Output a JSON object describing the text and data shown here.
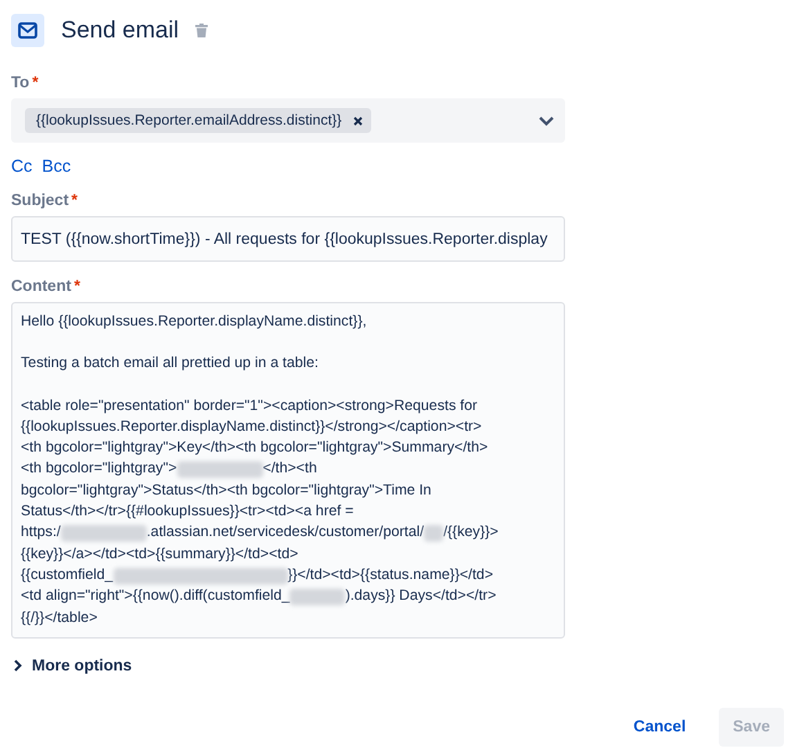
{
  "header": {
    "title": "Send email"
  },
  "to": {
    "label": "To",
    "required_mark": "*",
    "tags": [
      {
        "text": "{{lookupIssues.Reporter.emailAddress.distinct}}"
      }
    ]
  },
  "copy_links": [
    "Cc",
    "Bcc"
  ],
  "subject": {
    "label": "Subject",
    "required_mark": "*",
    "value": "TEST ({{now.shortTime}}) - All requests for {{lookupIssues.Reporter.display"
  },
  "content": {
    "label": "Content",
    "required_mark": "*",
    "paragraphs": [
      [
        [
          {
            "kind": "text",
            "text": "Hello {{lookupIssues.Reporter.displayName.distinct}},"
          }
        ]
      ],
      [
        [
          {
            "kind": "text",
            "text": "Testing a batch email all prettied up in a table:"
          }
        ]
      ],
      [
        [
          {
            "kind": "text",
            "text": "<table role=\"presentation\" border=\"1\"><caption><strong>Requests for"
          }
        ],
        [
          {
            "kind": "text",
            "text": "{{lookupIssues.Reporter.displayName.distinct}}</strong></caption><tr>"
          }
        ],
        [
          {
            "kind": "text",
            "text": "<th bgcolor=\"lightgray\">Key</th><th bgcolor=\"lightgray\">Summary</th>"
          }
        ],
        [
          {
            "kind": "text",
            "text": "<th bgcolor=\"lightgray\">"
          },
          {
            "kind": "blurmedium"
          },
          {
            "kind": "text",
            "text": "</th><th"
          }
        ],
        [
          {
            "kind": "text",
            "text": "bgcolor=\"lightgray\">Status</th><th bgcolor=\"lightgray\">Time In"
          }
        ],
        [
          {
            "kind": "text",
            "text": "Status</th></tr>{{#lookupIssues}}<tr><td><a href ="
          }
        ],
        [
          {
            "kind": "text",
            "text": "https:/"
          },
          {
            "kind": "blurmedium"
          },
          {
            "kind": "text",
            "text": ".atlassian.net/servicedesk/customer/portal/"
          },
          {
            "kind": "blurtiny"
          },
          {
            "kind": "text",
            "text": "/{{key}}>"
          }
        ],
        [
          {
            "kind": "text",
            "text": "{{key}}</a></td><td>{{summary}}</td><td>"
          }
        ],
        [
          {
            "kind": "text",
            "text": "{{customfield_"
          },
          {
            "kind": "blurlong"
          },
          {
            "kind": "text",
            "text": "}}</td><td>{{status.name}}</td>"
          }
        ],
        [
          {
            "kind": "text",
            "text": "<td align=\"right\">{{now().diff(customfield_"
          },
          {
            "kind": "blurshort"
          },
          {
            "kind": "text",
            "text": ").days}} Days</td></tr>"
          }
        ],
        [
          {
            "kind": "text",
            "text": "{{/}}</table>"
          }
        ]
      ]
    ]
  },
  "more_options": {
    "label": "More options",
    "expanded": false
  },
  "buttons": [
    {
      "label": "Cancel",
      "kind": "link",
      "disabled": false
    },
    {
      "label": "Save",
      "kind": "primary",
      "disabled": true
    }
  ]
}
